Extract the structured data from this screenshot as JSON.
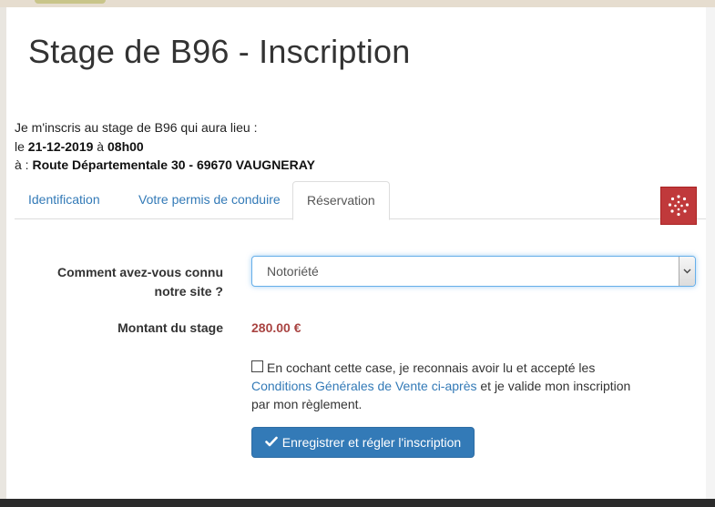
{
  "page": {
    "title": "Stage de B96 - Inscription"
  },
  "intro": {
    "line1": "Je m'inscris au stage de B96 qui aura lieu :",
    "date_prefix": "le ",
    "date": "21-12-2019",
    "time_prefix": " à ",
    "time": "08h00",
    "place_prefix": "à : ",
    "place": "Route Départementale 30 - 69670 VAUGNERAY"
  },
  "tabs": [
    {
      "label": "Identification",
      "active": false
    },
    {
      "label": "Votre permis de conduire",
      "active": false
    },
    {
      "label": "Réservation",
      "active": true
    }
  ],
  "form": {
    "source_label_line1": "Comment avez-vous connu",
    "source_label_line2": "notre site ?",
    "source_value": "Notoriété",
    "price_label": "Montant du stage",
    "price_value": "280.00 €",
    "cgv_before": "En cochant cette case, je reconnais avoir lu et accepté les",
    "cgv_link": "Conditions Générales de Vente ci-après",
    "cgv_after": " et je valide mon inscription par mon règlement.",
    "cgv_checked": false,
    "submit_label": "Enregistrer et régler l'inscription"
  },
  "icons": {
    "widget": "dots-circle-icon",
    "submit": "check-icon",
    "select": "chevron-down-icon"
  },
  "colors": {
    "link": "#337ab7",
    "price": "#a94442",
    "primary_button": "#337ab7",
    "widget": "#c0393b"
  }
}
